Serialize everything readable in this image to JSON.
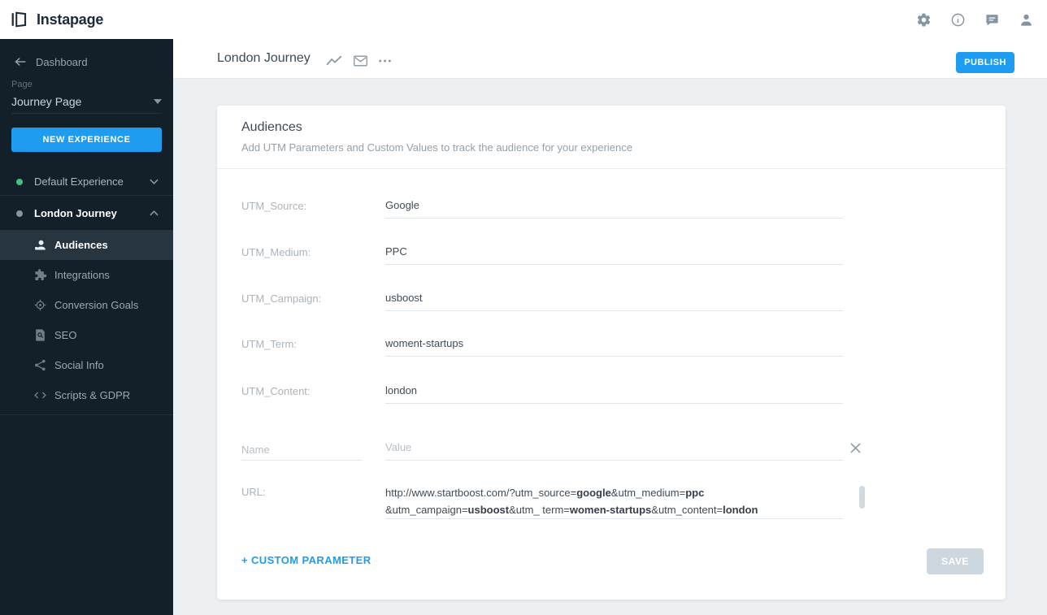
{
  "app": {
    "logo_text": "Instapage"
  },
  "header": {
    "icons": [
      "settings-icon",
      "info-icon",
      "messages-icon",
      "account-icon"
    ]
  },
  "sidebar": {
    "back_label": "Dashboard",
    "page_label": "Page",
    "page_selected": "Journey Page",
    "new_experience_label": "NEW EXPERIENCE",
    "experiences": [
      {
        "label": "Default Experience",
        "dot_color": "#43c17d",
        "state": "collapsed"
      },
      {
        "label": "London Journey",
        "dot_color": "#8595a1",
        "state": "expanded"
      }
    ],
    "menu": [
      {
        "label": "Audiences",
        "icon": "audiences-icon",
        "active": true
      },
      {
        "label": "Integrations",
        "icon": "integrations-icon",
        "active": false
      },
      {
        "label": "Conversion Goals",
        "icon": "conversion-goals-icon",
        "active": false
      },
      {
        "label": "SEO",
        "icon": "seo-icon",
        "active": false
      },
      {
        "label": "Social Info",
        "icon": "social-info-icon",
        "active": false
      },
      {
        "label": "Scripts & GDPR",
        "icon": "scripts-gdpr-icon",
        "active": false
      }
    ]
  },
  "topbar": {
    "title": "London Journey",
    "title_icons": [
      "trend-chart-icon",
      "envelope-icon",
      "more-options-icon"
    ],
    "publish_label": "PUBLISH"
  },
  "card": {
    "title": "Audiences",
    "subtitle": "Add UTM Parameters and Custom Values to track the audience for your experience",
    "fields": [
      {
        "label": "UTM_Source:",
        "value": "Google"
      },
      {
        "label": "UTM_Medium:",
        "value": "PPC"
      },
      {
        "label": "UTM_Campaign:",
        "value": "usboost"
      },
      {
        "label": "UTM_Term:",
        "value": "woment-startups"
      },
      {
        "label": "UTM_Content:",
        "value": "london"
      }
    ],
    "custom_row": {
      "name_placeholder": "Name",
      "value_placeholder": "Value"
    },
    "url": {
      "label": "URL:",
      "lines": [
        [
          {
            "t": "http://www.startboost.com/?utm_source=",
            "b": false
          },
          {
            "t": "google",
            "b": true
          },
          {
            "t": "&utm_medium=",
            "b": false
          },
          {
            "t": "ppc",
            "b": true
          }
        ],
        [
          {
            "t": "&utm_campaign=",
            "b": false
          },
          {
            "t": "usboost",
            "b": true
          },
          {
            "t": "&utm_ term=",
            "b": false
          },
          {
            "t": "women-startups",
            "b": true
          },
          {
            "t": "&utm_content=",
            "b": false
          },
          {
            "t": "london",
            "b": true
          }
        ]
      ]
    },
    "add_param_label": "+ CUSTOM PARAMETER",
    "save_label": "SAVE"
  },
  "colors": {
    "accent": "#1e9cf0",
    "save_disabled": "#ccd7df",
    "sidebar_bg": "#13202a",
    "sidebar_active_bg": "#273540",
    "green_dot": "#43c17d",
    "gray_dot": "#8595a1"
  }
}
